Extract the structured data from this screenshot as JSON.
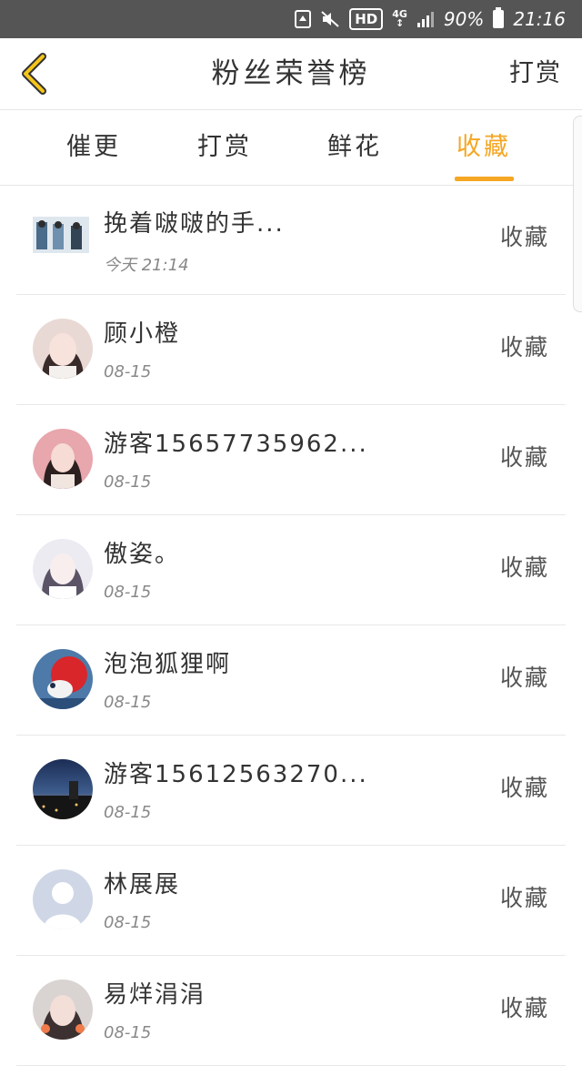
{
  "status_bar": {
    "hd": "HD",
    "network": "4G",
    "battery": "90%",
    "time": "21:16"
  },
  "nav": {
    "title": "粉丝荣誉榜",
    "right_action": "打赏"
  },
  "tabs": [
    {
      "label": "催更"
    },
    {
      "label": "打赏"
    },
    {
      "label": "鲜花"
    },
    {
      "label": "收藏"
    }
  ],
  "active_tab": "收藏",
  "colors": {
    "accent": "#f5a623",
    "status_bar": "#555555"
  },
  "list": [
    {
      "name": "挽着啵啵的手...",
      "date": "今天 21:14",
      "action": "收藏",
      "avatar": "group-photo"
    },
    {
      "name": "顾小橙",
      "date": "08-15",
      "action": "收藏",
      "avatar": "portrait"
    },
    {
      "name": "游客15657735962...",
      "date": "08-15",
      "action": "收藏",
      "avatar": "portrait"
    },
    {
      "name": "傲姿。",
      "date": "08-15",
      "action": "收藏",
      "avatar": "portrait"
    },
    {
      "name": "泡泡狐狸啊",
      "date": "08-15",
      "action": "收藏",
      "avatar": "fox"
    },
    {
      "name": "游客15612563270...",
      "date": "08-15",
      "action": "收藏",
      "avatar": "night-city"
    },
    {
      "name": "林展展",
      "date": "08-15",
      "action": "收藏",
      "avatar": "default-user"
    },
    {
      "name": "易烊涓涓",
      "date": "08-15",
      "action": "收藏",
      "avatar": "portrait"
    }
  ]
}
